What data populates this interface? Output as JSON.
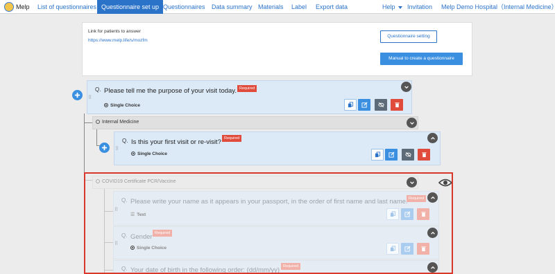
{
  "nav": {
    "logo_text": "Melp",
    "items": [
      {
        "label": "List of questionnaires",
        "active": false
      },
      {
        "label": "Questionnaire set up",
        "active": true
      },
      {
        "label": "Questionnaires",
        "active": false
      },
      {
        "label": "Data summary",
        "active": false
      },
      {
        "label": "Materials",
        "active": false
      },
      {
        "label": "Label",
        "active": false
      },
      {
        "label": "Export data",
        "active": false
      }
    ],
    "help": "Help",
    "invitation": "Invitation",
    "hospital": "Melp Demo Hospital（Internal Medicine）"
  },
  "link_panel": {
    "label": "Link for patients to answer",
    "url": "https://www.melp.life/s/mozfm",
    "setting_button": "Questionnaire setting",
    "manual_button": "Manual to create a questionnaire"
  },
  "questions": [
    {
      "prefix": "Q.",
      "text": "Please tell me the purpose of your visit today.",
      "required": "Required",
      "type": "Single Choice"
    },
    {
      "prefix": "Q.",
      "text": "Is this your first visit or re-visit?",
      "required": "Required",
      "type": "Single Choice"
    },
    {
      "prefix": "Q.",
      "text": "Please write your name as it appears in your passport, in the order of first name and last name.",
      "required": "Required",
      "type": "Text"
    },
    {
      "prefix": "Q.",
      "text": "Gender",
      "required": "Required",
      "type": "Single Choice"
    },
    {
      "prefix": "Q.",
      "text": "Your date of birth in the following order: (dd/mm/yy)",
      "required": "Required"
    }
  ],
  "groups": [
    {
      "title": "Internal Medicine"
    },
    {
      "title": "COVID19 Certificate PCR/Vaccine"
    }
  ],
  "colors": {
    "accent": "#2a73c9",
    "required": "#e04b3c",
    "highlight": "#d9372c"
  }
}
